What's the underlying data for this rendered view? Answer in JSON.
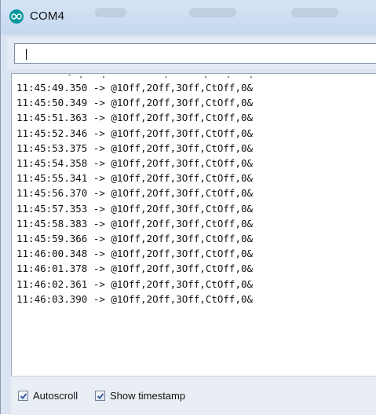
{
  "window": {
    "title": "COM4"
  },
  "input": {
    "value": ""
  },
  "log": {
    "lines": [
      "11:45:49.350 -> @1Off,2Off,3Off,CtOff,0&",
      "11:45:50.349 -> @1Off,2Off,3Off,CtOff,0&",
      "11:45:51.363 -> @1Off,2Off,3Off,CtOff,0&",
      "11:45:52.346 -> @1Off,2Off,3Off,CtOff,0&",
      "11:45:53.375 -> @1Off,2Off,3Off,CtOff,0&",
      "11:45:54.358 -> @1Off,2Off,3Off,CtOff,0&",
      "11:45:55.341 -> @1Off,2Off,3Off,CtOff,0&",
      "11:45:56.370 -> @1Off,2Off,3Off,CtOff,0&",
      "11:45:57.353 -> @1Off,2Off,3Off,CtOff,0&",
      "11:45:58.383 -> @1Off,2Off,3Off,CtOff,0&",
      "11:45:59.366 -> @1Off,2Off,3Off,CtOff,0&",
      "11:46:00.348 -> @1Off,2Off,3Off,CtOff,0&",
      "11:46:01.378 -> @1Off,2Off,3Off,CtOff,0&",
      "11:46:02.361 -> @1Off,2Off,3Off,CtOff,0&",
      "11:46:03.390 -> @1Off,2Off,3Off,CtOff,0&"
    ]
  },
  "footer": {
    "autoscroll": {
      "label": "Autoscroll",
      "checked": true
    },
    "timestamp": {
      "label": "Show timestamp",
      "checked": true
    }
  },
  "colors": {
    "accent": "#00979d",
    "titlebar": "#c6d8ef"
  },
  "icons": {
    "app": "arduino-infinity-icon",
    "check": "checkmark-icon"
  }
}
